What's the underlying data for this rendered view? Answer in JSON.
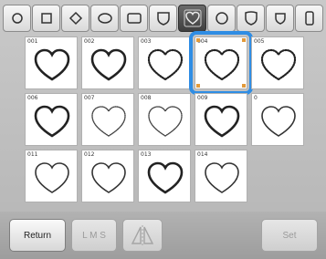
{
  "shape_tabs": [
    {
      "icon": "circle-shape-icon"
    },
    {
      "icon": "square-shape-icon"
    },
    {
      "icon": "diamond-shape-icon"
    },
    {
      "icon": "oval-shape-icon"
    },
    {
      "icon": "rounded-rect-shape-icon"
    },
    {
      "icon": "shield-shape-icon"
    },
    {
      "icon": "heart-shape-icon",
      "selected": true
    },
    {
      "icon": "circle-outline-shape-icon"
    },
    {
      "icon": "crest-shape-icon"
    },
    {
      "icon": "shield-small-shape-icon"
    },
    {
      "icon": "tall-rect-shape-icon"
    }
  ],
  "patterns": [
    {
      "num": "001",
      "style": "bold"
    },
    {
      "num": "002",
      "style": "bold"
    },
    {
      "num": "003",
      "style": "dotted"
    },
    {
      "num": "004",
      "style": "dotted",
      "selected": true
    },
    {
      "num": "005",
      "style": "dotted"
    },
    {
      "num": "006",
      "style": "bold"
    },
    {
      "num": "007",
      "style": "light"
    },
    {
      "num": "008",
      "style": "light"
    },
    {
      "num": "009",
      "style": "bold"
    },
    {
      "num": "0",
      "style": "thin"
    },
    {
      "num": "011",
      "style": "thin"
    },
    {
      "num": "012",
      "style": "thin"
    },
    {
      "num": "013",
      "style": "bold"
    },
    {
      "num": "014",
      "style": "thin"
    }
  ],
  "buttons": {
    "return_label": "Return",
    "size_label": "L M S",
    "set_label": "Set"
  },
  "colors": {
    "selection_frame": "#2f8de4",
    "selected_tab": "#4a4a4a"
  }
}
